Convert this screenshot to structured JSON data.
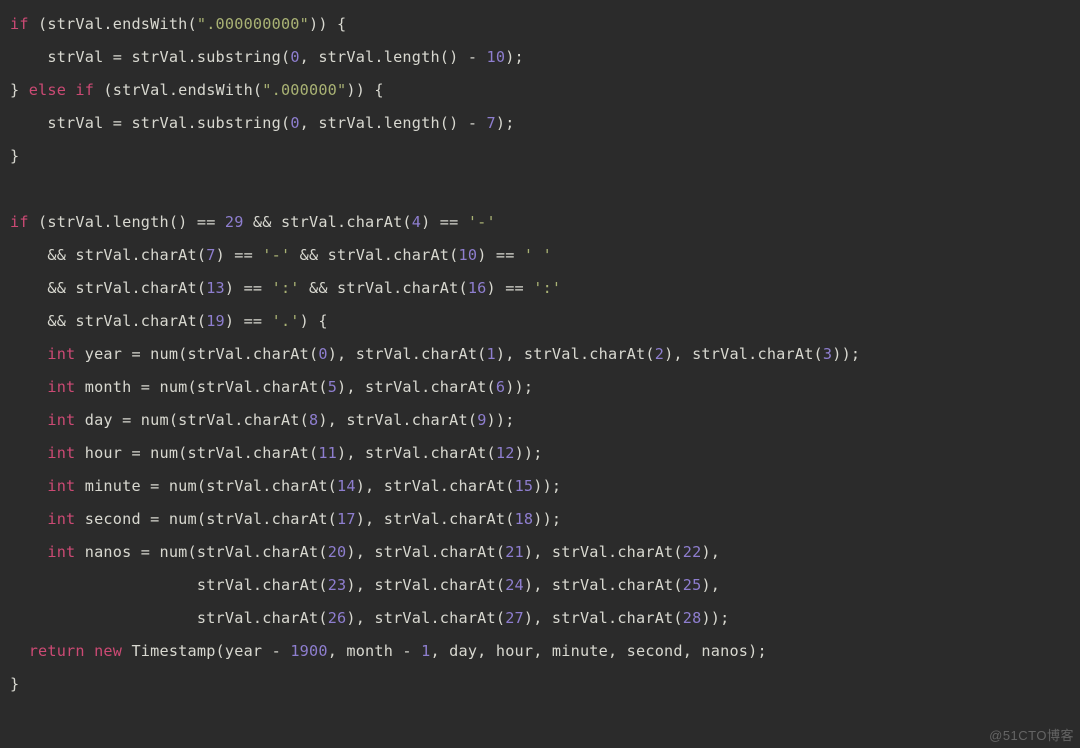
{
  "watermark": "@51CTO博客",
  "code": {
    "lines": [
      [
        {
          "c": "kw",
          "t": "if"
        },
        {
          "c": "pun",
          "t": " (strVal.endsWith("
        },
        {
          "c": "str",
          "t": "\".000000000\""
        },
        {
          "c": "pun",
          "t": ")) {"
        }
      ],
      [
        {
          "c": "pun",
          "t": "    strVal = strVal.substring("
        },
        {
          "c": "num",
          "t": "0"
        },
        {
          "c": "pun",
          "t": ", strVal.length() - "
        },
        {
          "c": "num",
          "t": "10"
        },
        {
          "c": "pun",
          "t": ");"
        }
      ],
      [
        {
          "c": "pun",
          "t": "} "
        },
        {
          "c": "kw",
          "t": "else"
        },
        {
          "c": "pun",
          "t": " "
        },
        {
          "c": "kw",
          "t": "if"
        },
        {
          "c": "pun",
          "t": " (strVal.endsWith("
        },
        {
          "c": "str",
          "t": "\".000000\""
        },
        {
          "c": "pun",
          "t": ")) {"
        }
      ],
      [
        {
          "c": "pun",
          "t": "    strVal = strVal.substring("
        },
        {
          "c": "num",
          "t": "0"
        },
        {
          "c": "pun",
          "t": ", strVal.length() - "
        },
        {
          "c": "num",
          "t": "7"
        },
        {
          "c": "pun",
          "t": ");"
        }
      ],
      [
        {
          "c": "pun",
          "t": "}"
        }
      ],
      [
        {
          "c": "pun",
          "t": ""
        }
      ],
      [
        {
          "c": "kw",
          "t": "if"
        },
        {
          "c": "pun",
          "t": " (strVal.length() == "
        },
        {
          "c": "num",
          "t": "29"
        },
        {
          "c": "pun",
          "t": " && strVal.charAt("
        },
        {
          "c": "num",
          "t": "4"
        },
        {
          "c": "pun",
          "t": ") == "
        },
        {
          "c": "chr",
          "t": "'-'"
        }
      ],
      [
        {
          "c": "pun",
          "t": "    && strVal.charAt("
        },
        {
          "c": "num",
          "t": "7"
        },
        {
          "c": "pun",
          "t": ") == "
        },
        {
          "c": "chr",
          "t": "'-'"
        },
        {
          "c": "pun",
          "t": " && strVal.charAt("
        },
        {
          "c": "num",
          "t": "10"
        },
        {
          "c": "pun",
          "t": ") == "
        },
        {
          "c": "chr",
          "t": "' '"
        }
      ],
      [
        {
          "c": "pun",
          "t": "    && strVal.charAt("
        },
        {
          "c": "num",
          "t": "13"
        },
        {
          "c": "pun",
          "t": ") == "
        },
        {
          "c": "chr",
          "t": "':'"
        },
        {
          "c": "pun",
          "t": " && strVal.charAt("
        },
        {
          "c": "num",
          "t": "16"
        },
        {
          "c": "pun",
          "t": ") == "
        },
        {
          "c": "chr",
          "t": "':'"
        }
      ],
      [
        {
          "c": "pun",
          "t": "    && strVal.charAt("
        },
        {
          "c": "num",
          "t": "19"
        },
        {
          "c": "pun",
          "t": ") == "
        },
        {
          "c": "chr",
          "t": "'.'"
        },
        {
          "c": "pun",
          "t": ") {"
        }
      ],
      [
        {
          "c": "pun",
          "t": "    "
        },
        {
          "c": "kw",
          "t": "int"
        },
        {
          "c": "pun",
          "t": " year = num(strVal.charAt("
        },
        {
          "c": "num",
          "t": "0"
        },
        {
          "c": "pun",
          "t": "), strVal.charAt("
        },
        {
          "c": "num",
          "t": "1"
        },
        {
          "c": "pun",
          "t": "), strVal.charAt("
        },
        {
          "c": "num",
          "t": "2"
        },
        {
          "c": "pun",
          "t": "), strVal.charAt("
        },
        {
          "c": "num",
          "t": "3"
        },
        {
          "c": "pun",
          "t": "));"
        }
      ],
      [
        {
          "c": "pun",
          "t": "    "
        },
        {
          "c": "kw",
          "t": "int"
        },
        {
          "c": "pun",
          "t": " month = num(strVal.charAt("
        },
        {
          "c": "num",
          "t": "5"
        },
        {
          "c": "pun",
          "t": "), strVal.charAt("
        },
        {
          "c": "num",
          "t": "6"
        },
        {
          "c": "pun",
          "t": "));"
        }
      ],
      [
        {
          "c": "pun",
          "t": "    "
        },
        {
          "c": "kw",
          "t": "int"
        },
        {
          "c": "pun",
          "t": " day = num(strVal.charAt("
        },
        {
          "c": "num",
          "t": "8"
        },
        {
          "c": "pun",
          "t": "), strVal.charAt("
        },
        {
          "c": "num",
          "t": "9"
        },
        {
          "c": "pun",
          "t": "));"
        }
      ],
      [
        {
          "c": "pun",
          "t": "    "
        },
        {
          "c": "kw",
          "t": "int"
        },
        {
          "c": "pun",
          "t": " hour = num(strVal.charAt("
        },
        {
          "c": "num",
          "t": "11"
        },
        {
          "c": "pun",
          "t": "), strVal.charAt("
        },
        {
          "c": "num",
          "t": "12"
        },
        {
          "c": "pun",
          "t": "));"
        }
      ],
      [
        {
          "c": "pun",
          "t": "    "
        },
        {
          "c": "kw",
          "t": "int"
        },
        {
          "c": "pun",
          "t": " minute = num(strVal.charAt("
        },
        {
          "c": "num",
          "t": "14"
        },
        {
          "c": "pun",
          "t": "), strVal.charAt("
        },
        {
          "c": "num",
          "t": "15"
        },
        {
          "c": "pun",
          "t": "));"
        }
      ],
      [
        {
          "c": "pun",
          "t": "    "
        },
        {
          "c": "kw",
          "t": "int"
        },
        {
          "c": "pun",
          "t": " second = num(strVal.charAt("
        },
        {
          "c": "num",
          "t": "17"
        },
        {
          "c": "pun",
          "t": "), strVal.charAt("
        },
        {
          "c": "num",
          "t": "18"
        },
        {
          "c": "pun",
          "t": "));"
        }
      ],
      [
        {
          "c": "pun",
          "t": "    "
        },
        {
          "c": "kw",
          "t": "int"
        },
        {
          "c": "pun",
          "t": " nanos = num(strVal.charAt("
        },
        {
          "c": "num",
          "t": "20"
        },
        {
          "c": "pun",
          "t": "), strVal.charAt("
        },
        {
          "c": "num",
          "t": "21"
        },
        {
          "c": "pun",
          "t": "), strVal.charAt("
        },
        {
          "c": "num",
          "t": "22"
        },
        {
          "c": "pun",
          "t": "),"
        }
      ],
      [
        {
          "c": "pun",
          "t": "                    strVal.charAt("
        },
        {
          "c": "num",
          "t": "23"
        },
        {
          "c": "pun",
          "t": "), strVal.charAt("
        },
        {
          "c": "num",
          "t": "24"
        },
        {
          "c": "pun",
          "t": "), strVal.charAt("
        },
        {
          "c": "num",
          "t": "25"
        },
        {
          "c": "pun",
          "t": "),"
        }
      ],
      [
        {
          "c": "pun",
          "t": "                    strVal.charAt("
        },
        {
          "c": "num",
          "t": "26"
        },
        {
          "c": "pun",
          "t": "), strVal.charAt("
        },
        {
          "c": "num",
          "t": "27"
        },
        {
          "c": "pun",
          "t": "), strVal.charAt("
        },
        {
          "c": "num",
          "t": "28"
        },
        {
          "c": "pun",
          "t": "));"
        }
      ],
      [
        {
          "c": "pun",
          "t": "  "
        },
        {
          "c": "kw",
          "t": "return"
        },
        {
          "c": "pun",
          "t": " "
        },
        {
          "c": "kw",
          "t": "new"
        },
        {
          "c": "pun",
          "t": " Timestamp(year - "
        },
        {
          "c": "num",
          "t": "1900"
        },
        {
          "c": "pun",
          "t": ", month - "
        },
        {
          "c": "num",
          "t": "1"
        },
        {
          "c": "pun",
          "t": ", day, hour, minute, second, nanos);"
        }
      ],
      [
        {
          "c": "pun",
          "t": "}"
        }
      ]
    ]
  }
}
